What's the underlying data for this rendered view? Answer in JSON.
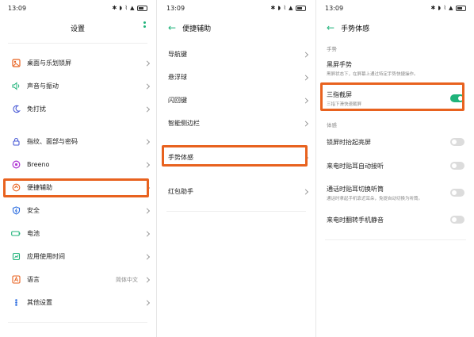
{
  "status": {
    "time": "13:09",
    "icons": "✱ ◗ ⌇ ▲"
  },
  "panel1": {
    "title": "设置",
    "items": [
      {
        "label": "桌面与乐划锁屏",
        "icon": "wallpaper-icon",
        "color": "#e8621f"
      },
      {
        "label": "声音与振动",
        "icon": "sound-icon",
        "color": "#1fb37a"
      },
      {
        "label": "免打扰",
        "icon": "moon-icon",
        "color": "#4a5bd6"
      },
      {
        "label": "指纹、面部与密码",
        "icon": "lock-icon",
        "color": "#4a5bd6"
      },
      {
        "label": "Breeno",
        "icon": "breeno-icon",
        "color": "#b23cd6"
      },
      {
        "label": "便捷辅助",
        "icon": "assist-icon",
        "color": "#e8621f"
      },
      {
        "label": "安全",
        "icon": "shield-icon",
        "color": "#2f6fe0"
      },
      {
        "label": "电池",
        "icon": "battery-icon",
        "color": "#1fb37a"
      },
      {
        "label": "应用使用时间",
        "icon": "app-time-icon",
        "color": "#1fb37a"
      },
      {
        "label": "语言",
        "icon": "language-icon",
        "color": "#e8621f",
        "value": "简体中文"
      },
      {
        "label": "其他设置",
        "icon": "other-settings-icon",
        "color": "#2f6fe0"
      }
    ]
  },
  "panel2": {
    "title": "便捷辅助",
    "items": [
      {
        "label": "导航键"
      },
      {
        "label": "悬浮球"
      },
      {
        "label": "闪回键"
      },
      {
        "label": "智能侧边栏"
      },
      {
        "label": "手势体感"
      },
      {
        "label": "红包助手"
      }
    ]
  },
  "panel3": {
    "title": "手势体感",
    "section1": "手势",
    "gesture": {
      "label": "黑屏手势",
      "sub": "黑屏状态下，在屏幕上通过特定手势快捷操作。"
    },
    "three_finger": {
      "label": "三指截屏",
      "sub": "三指下滑快速截屏",
      "on": true
    },
    "section2": "体感",
    "toggles": [
      {
        "label": "锁屏时抬起亮屏",
        "sub": "",
        "on": false
      },
      {
        "label": "来电时贴耳自动接听",
        "sub": "",
        "on": false
      },
      {
        "label": "通话时贴耳切换听筒",
        "sub": "通话时拿起手机靠近耳朵，免提自动切换为听筒。",
        "on": false
      },
      {
        "label": "来电时翻转手机静音",
        "sub": "",
        "on": false
      }
    ]
  },
  "colors": {
    "accent": "#1fb37a",
    "highlight": "#e8621f"
  }
}
